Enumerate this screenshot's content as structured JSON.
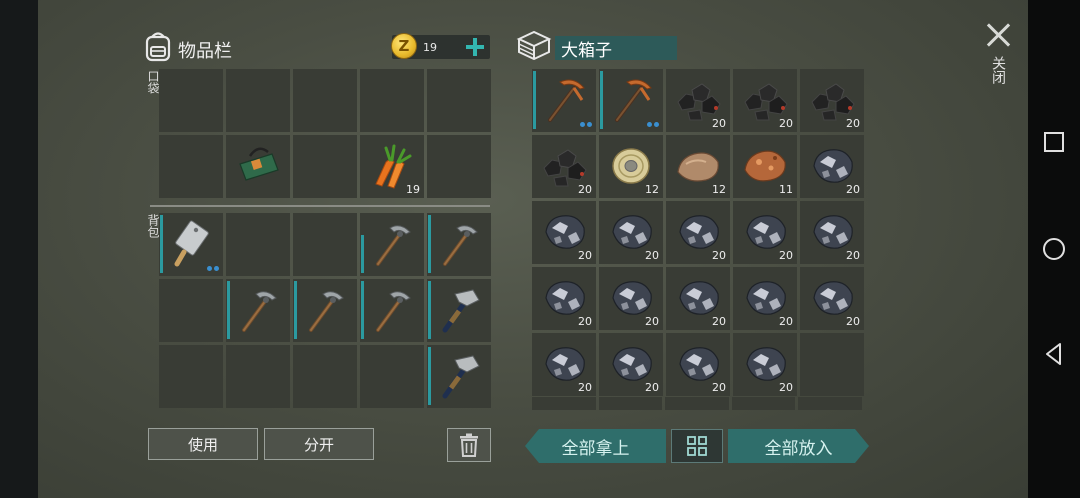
{
  "inventory": {
    "title": "物品栏",
    "coins": "19",
    "pocket_label": "口袋",
    "backpack_label": "背包"
  },
  "box": {
    "title": "大箱子"
  },
  "close_label": "关闭",
  "buttons": {
    "use": "使用",
    "split": "分开",
    "take_all": "全部拿上",
    "put_all": "全部放入"
  },
  "pocket_slots": [
    {
      "item": "",
      "count": ""
    },
    {
      "item": "",
      "count": ""
    },
    {
      "item": "",
      "count": ""
    },
    {
      "item": "",
      "count": ""
    },
    {
      "item": "",
      "count": ""
    },
    {
      "item": "",
      "count": ""
    },
    {
      "item": "backpack-bag",
      "count": ""
    },
    {
      "item": "",
      "count": ""
    },
    {
      "item": "carrot",
      "count": "19"
    },
    {
      "item": "",
      "count": ""
    }
  ],
  "backpack_slots": [
    {
      "item": "cleaver",
      "count": "",
      "dots": true,
      "bar": "full"
    },
    {
      "item": "",
      "count": ""
    },
    {
      "item": "",
      "count": ""
    },
    {
      "item": "stone-pickaxe",
      "count": "",
      "bar": "short"
    },
    {
      "item": "stone-pickaxe",
      "count": "",
      "bar": "full"
    },
    {
      "item": "",
      "count": ""
    },
    {
      "item": "stone-pickaxe",
      "count": "",
      "bar": "full"
    },
    {
      "item": "stone-pickaxe",
      "count": "",
      "bar": "full"
    },
    {
      "item": "stone-pickaxe",
      "count": "",
      "bar": "full"
    },
    {
      "item": "iron-hammer",
      "count": "",
      "bar": "full"
    },
    {
      "item": "",
      "count": ""
    },
    {
      "item": "",
      "count": ""
    },
    {
      "item": "",
      "count": ""
    },
    {
      "item": "",
      "count": ""
    },
    {
      "item": "iron-hammer",
      "count": "",
      "bar": "full"
    }
  ],
  "box_slots": [
    {
      "item": "copper-pickaxe",
      "count": "",
      "dots": true,
      "bar": "full"
    },
    {
      "item": "copper-pickaxe",
      "count": "",
      "dots": true,
      "bar": "full"
    },
    {
      "item": "coal",
      "count": "20"
    },
    {
      "item": "coal",
      "count": "20"
    },
    {
      "item": "coal",
      "count": "20"
    },
    {
      "item": "coal",
      "count": "20"
    },
    {
      "item": "rope-coil",
      "count": "12"
    },
    {
      "item": "stone",
      "count": "12"
    },
    {
      "item": "copper-ore",
      "count": "11"
    },
    {
      "item": "iron-ore",
      "count": "20"
    },
    {
      "item": "iron-ore",
      "count": "20"
    },
    {
      "item": "iron-ore",
      "count": "20"
    },
    {
      "item": "iron-ore",
      "count": "20"
    },
    {
      "item": "iron-ore",
      "count": "20"
    },
    {
      "item": "iron-ore",
      "count": "20"
    },
    {
      "item": "iron-ore",
      "count": "20"
    },
    {
      "item": "iron-ore",
      "count": "20"
    },
    {
      "item": "iron-ore",
      "count": "20"
    },
    {
      "item": "iron-ore",
      "count": "20"
    },
    {
      "item": "iron-ore",
      "count": "20"
    },
    {
      "item": "iron-ore",
      "count": "20"
    },
    {
      "item": "iron-ore",
      "count": "20"
    },
    {
      "item": "iron-ore",
      "count": "20"
    },
    {
      "item": "iron-ore",
      "count": "20"
    },
    {
      "item": "",
      "count": ""
    }
  ],
  "colors": {
    "accent": "#2f6e6b",
    "durability_bar": "#2b9aa0",
    "plus": "#33b6b0"
  }
}
